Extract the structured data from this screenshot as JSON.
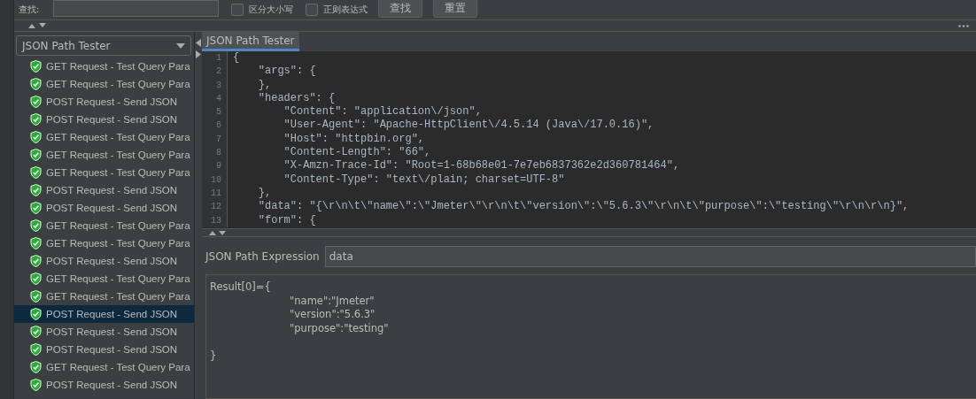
{
  "search_bar": {
    "label": "查找:",
    "options": [
      {
        "label": "区分大小写",
        "checked": false
      },
      {
        "label": "正则表达式",
        "checked": false
      }
    ],
    "buttons": [
      "查找",
      "重置"
    ]
  },
  "sidebar": {
    "dropdown": "JSON Path Tester",
    "items": [
      {
        "label": "GET Request - Test Query Para",
        "selected": false
      },
      {
        "label": "GET Request - Test Query Para",
        "selected": false
      },
      {
        "label": "POST Request - Send JSON",
        "selected": false
      },
      {
        "label": "POST Request - Send JSON",
        "selected": false
      },
      {
        "label": "GET Request - Test Query Para",
        "selected": false
      },
      {
        "label": "GET Request - Test Query Para",
        "selected": false
      },
      {
        "label": "GET Request - Test Query Para",
        "selected": false
      },
      {
        "label": "POST Request - Send JSON",
        "selected": false
      },
      {
        "label": "POST Request - Send JSON",
        "selected": false
      },
      {
        "label": "GET Request - Test Query Para",
        "selected": false
      },
      {
        "label": "GET Request - Test Query Para",
        "selected": false
      },
      {
        "label": "POST Request - Send JSON",
        "selected": false
      },
      {
        "label": "GET Request - Test Query Para",
        "selected": false
      },
      {
        "label": "GET Request - Test Query Para",
        "selected": false
      },
      {
        "label": "POST Request - Send JSON",
        "selected": true
      },
      {
        "label": "POST Request - Send JSON",
        "selected": false
      },
      {
        "label": "POST Request - Send JSON",
        "selected": false
      },
      {
        "label": "GET Request - Test Query Para",
        "selected": false
      },
      {
        "label": "POST Request - Send JSON",
        "selected": false
      }
    ]
  },
  "tabs": [
    {
      "label": "JSON Path Tester",
      "selected": true
    }
  ],
  "editor": {
    "lines": [
      {
        "number": "1",
        "text": "{"
      },
      {
        "number": "2",
        "text": "    \"args\": {"
      },
      {
        "number": "3",
        "text": "    },"
      },
      {
        "number": "4",
        "text": "    \"headers\": {"
      },
      {
        "number": "5",
        "text": "        \"Content\": \"application\\/json\","
      },
      {
        "number": "6",
        "text": "        \"User-Agent\": \"Apache-HttpClient\\/4.5.14 (Java\\/17.0.16)\","
      },
      {
        "number": "7",
        "text": "        \"Host\": \"httpbin.org\","
      },
      {
        "number": "8",
        "text": "        \"Content-Length\": \"66\","
      },
      {
        "number": "9",
        "text": "        \"X-Amzn-Trace-Id\": \"Root=1-68b68e01-7e7eb6837362e2d360781464\","
      },
      {
        "number": "10",
        "text": "        \"Content-Type\": \"text\\/plain; charset=UTF-8\""
      },
      {
        "number": "11",
        "text": "    },"
      },
      {
        "number": "12",
        "text": "    \"data\": \"{\\r\\n\\t\\\"name\\\":\\\"Jmeter\\\"\\r\\n\\t\\\"version\\\":\\\"5.6.3\\\"\\r\\n\\t\\\"purpose\\\":\\\"testing\\\"\\r\\n\\r\\n}\","
      },
      {
        "number": "13",
        "text": "    \"form\": {"
      }
    ]
  },
  "expression": {
    "label": "JSON Path Expression",
    "value": "data"
  },
  "result": {
    "text": "Result[0]={\n\t\t\"name\":\"Jmeter\"\n\t\t\"version\":\"5.6.3\"\n\t\t\"purpose\":\"testing\"\n\n}"
  }
}
